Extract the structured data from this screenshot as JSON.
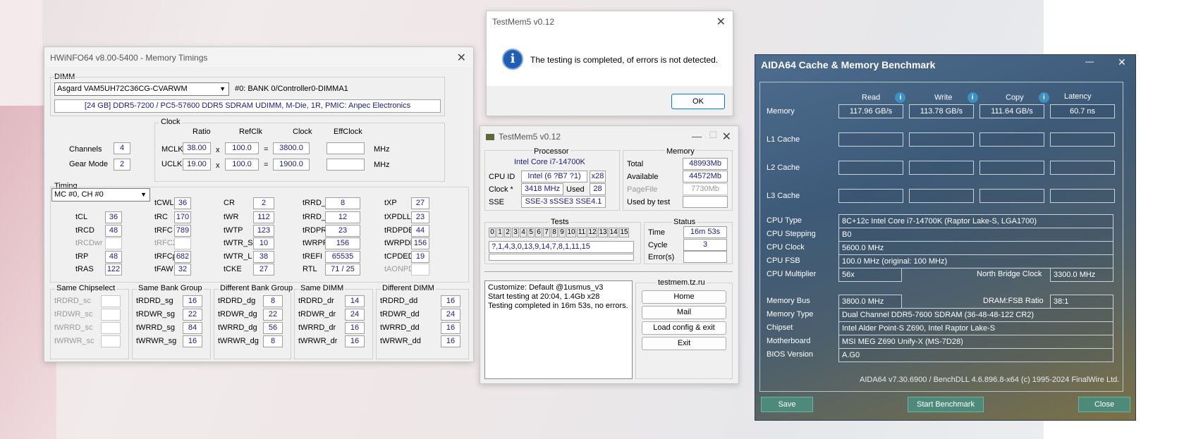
{
  "hw": {
    "title": "HWiNFO64 v8.00-5400 - Memory Timings",
    "dimm_label": "DIMM",
    "dimm_select": "Asgard VAM5UH72C36CG-CVARWM",
    "bank": "#0: BANK 0/Controller0-DIMMA1",
    "info": "[24 GB] DDR5-7200 / PC5-57600 DDR5 SDRAM UDIMM, M-Die, 1R, PMIC: Anpec Electronics",
    "clock_label": "Clock",
    "ratio": "Ratio",
    "refclk": "RefClk",
    "clock": "Clock",
    "effclock": "EffClock",
    "channels_label": "Channels",
    "channels": "4",
    "gear_label": "Gear Mode",
    "gear": "2",
    "mclk": "MCLK",
    "mclk_ratio": "38.00",
    "mclk_ref": "100.0",
    "mclk_clock": "3800.0",
    "uclk": "UCLK",
    "uclk_ratio": "19.00",
    "uclk_ref": "100.0",
    "uclk_clock": "1900.0",
    "x": "x",
    "eq": "=",
    "mhz": "MHz",
    "timing_label": "Timing",
    "mc_select": "MC #0, CH #0",
    "t": [
      [
        "tCL",
        "36"
      ],
      [
        "tRCD",
        "48"
      ],
      [
        "tRCDwr",
        ""
      ],
      [
        "tRP",
        "48"
      ],
      [
        "tRAS",
        "122"
      ],
      [
        "tCWL",
        "36"
      ],
      [
        "tRC",
        "170"
      ],
      [
        "tRFC",
        "789"
      ],
      [
        "tRFC2",
        ""
      ],
      [
        "tRFCpb",
        "682"
      ],
      [
        "tFAW",
        "32"
      ],
      [
        "CR",
        "2"
      ],
      [
        "tWR",
        "112"
      ],
      [
        "tWTP",
        "123"
      ],
      [
        "tWTR_S",
        "10"
      ],
      [
        "tWTR_L",
        "38"
      ],
      [
        "tCKE",
        "27"
      ],
      [
        "tRRD_S",
        "8"
      ],
      [
        "tRRD_L",
        "12"
      ],
      [
        "tRDPRE",
        "23"
      ],
      [
        "tWRPRE",
        "156"
      ],
      [
        "tREFI",
        "65535"
      ],
      [
        "RTL",
        "71 / 25"
      ],
      [
        "tXP",
        "27"
      ],
      [
        "tXPDLL",
        "23"
      ],
      [
        "tRDPDEN",
        "44"
      ],
      [
        "tWRPDEN",
        "156"
      ],
      [
        "tCPDED",
        "19"
      ],
      [
        "tAONPD",
        ""
      ]
    ],
    "groups": [
      {
        "title": "Same Chipselect",
        "rows": [
          [
            "tRDRD_sc",
            ""
          ],
          [
            "tRDWR_sc",
            ""
          ],
          [
            "tWRRD_sc",
            ""
          ],
          [
            "tWRWR_sc",
            ""
          ]
        ]
      },
      {
        "title": "Same Bank Group",
        "rows": [
          [
            "tRDRD_sg",
            "16"
          ],
          [
            "tRDWR_sg",
            "22"
          ],
          [
            "tWRRD_sg",
            "84"
          ],
          [
            "tWRWR_sg",
            "16"
          ]
        ]
      },
      {
        "title": "Different Bank Group",
        "rows": [
          [
            "tRDRD_dg",
            "8"
          ],
          [
            "tRDWR_dg",
            "22"
          ],
          [
            "tWRRD_dg",
            "56"
          ],
          [
            "tWRWR_dg",
            "8"
          ]
        ]
      },
      {
        "title": "Same DIMM",
        "rows": [
          [
            "tRDRD_dr",
            "14"
          ],
          [
            "tRDWR_dr",
            "24"
          ],
          [
            "tWRRD_dr",
            "16"
          ],
          [
            "tWRWR_dr",
            "16"
          ]
        ]
      },
      {
        "title": "Different DIMM",
        "rows": [
          [
            "tRDRD_dd",
            "16"
          ],
          [
            "tRDWR_dd",
            "24"
          ],
          [
            "tWRRD_dd",
            "16"
          ],
          [
            "tWRWR_dd",
            "16"
          ]
        ]
      }
    ]
  },
  "dlg": {
    "title": "TestMem5 v0.12",
    "message": "The testing is completed, of errors is not detected.",
    "ok": "OK"
  },
  "tm": {
    "title": "TestMem5 v0.12",
    "processor": "Processor",
    "cpu_name": "Intel Core i7-14700K",
    "cpuid_label": "CPU ID",
    "cpuid": "Intel  (6 ?B7 ?1)",
    "threads": "x28",
    "clock_label": "Clock *",
    "clock": "3418 MHz",
    "used_label": "Used",
    "used": "28",
    "sse_label": "SSE",
    "sse": "SSE-3 sSSE3 SSE4.1",
    "memory": "Memory",
    "total_label": "Total",
    "total": "48993Mb",
    "avail_label": "Available",
    "avail": "44572Mb",
    "pagefile_label": "PageFile",
    "pagefile": "7730Mb",
    "usedby_label": "Used by test",
    "usedby": "",
    "tests": "Tests",
    "test_nums": [
      "0",
      "1",
      "2",
      "3",
      "4",
      "5",
      "6",
      "7",
      "8",
      "9",
      "10",
      "11",
      "12",
      "13",
      "14",
      "15"
    ],
    "sequence": "?,1,4,3,0,13,9,14,7,8,1,11,15",
    "status": "Status",
    "time_label": "Time",
    "time": "16m 53s",
    "cycle_label": "Cycle",
    "cycle": "3",
    "errors_label": "Error(s)",
    "errors": "",
    "log": [
      "Customize: Default @1usmus_v3",
      "Start testing at 20:04, 1.4Gb x28",
      "Testing completed in 16m 53s, no errors."
    ],
    "site": "testmem.tz.ru",
    "home": "Home",
    "mail": "Mail",
    "load": "Load config & exit",
    "exit": "Exit"
  },
  "aida": {
    "title": "AIDA64 Cache & Memory Benchmark",
    "min": "—",
    "close_x": "✕",
    "read": "Read",
    "write": "Write",
    "copy": "Copy",
    "latency": "Latency",
    "rows": [
      {
        "label": "Memory",
        "read": "117.96 GB/s",
        "write": "113.78 GB/s",
        "copy": "111.64 GB/s",
        "lat": "60.7 ns"
      },
      {
        "label": "L1 Cache",
        "read": "",
        "write": "",
        "copy": "",
        "lat": ""
      },
      {
        "label": "L2 Cache",
        "read": "",
        "write": "",
        "copy": "",
        "lat": ""
      },
      {
        "label": "L3 Cache",
        "read": "",
        "write": "",
        "copy": "",
        "lat": ""
      }
    ],
    "cpu_type_l": "CPU Type",
    "cpu_type": "8C+12c Intel Core i7-14700K  (Raptor Lake-S, LGA1700)",
    "cpu_step_l": "CPU Stepping",
    "cpu_step": "B0",
    "cpu_clock_l": "CPU Clock",
    "cpu_clock": "5600.0 MHz",
    "cpu_fsb_l": "CPU FSB",
    "cpu_fsb": "100.0 MHz  (original: 100 MHz)",
    "cpu_mult_l": "CPU Multiplier",
    "cpu_mult": "56x",
    "nb_l": "North Bridge Clock",
    "nb": "3300.0 MHz",
    "mem_bus_l": "Memory Bus",
    "mem_bus": "3800.0 MHz",
    "dram_l": "DRAM:FSB Ratio",
    "dram": "38:1",
    "mem_type_l": "Memory Type",
    "mem_type": "Dual Channel DDR5-7600 SDRAM  (36-48-48-122 CR2)",
    "chipset_l": "Chipset",
    "chipset": "Intel Alder Point-S Z690, Intel Raptor Lake-S",
    "mobo_l": "Motherboard",
    "mobo": "MSI MEG Z690 Unify-X (MS-7D28)",
    "bios_l": "BIOS Version",
    "bios": "A.G0",
    "footer": "AIDA64 v7.30.6900 / BenchDLL 4.6.896.8-x64  (c) 1995-2024 FinalWire Ltd.",
    "save": "Save",
    "start": "Start Benchmark",
    "close": "Close"
  }
}
